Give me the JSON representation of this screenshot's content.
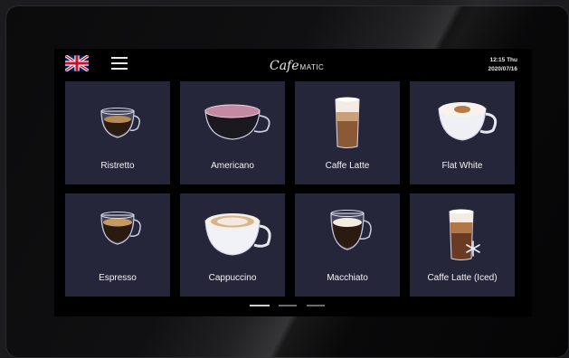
{
  "header": {
    "brand_script": "Cafe",
    "brand_suffix": "MATIC",
    "time": "12:15 Thu",
    "date": "2020/07/16",
    "language_icon": "uk-flag-icon",
    "menu_icon": "hamburger-menu-icon"
  },
  "drinks": [
    {
      "label": "Ristretto",
      "icon": "ristretto-cup-icon"
    },
    {
      "label": "Americano",
      "icon": "americano-cup-icon"
    },
    {
      "label": "Caffe Latte",
      "icon": "latte-glass-icon"
    },
    {
      "label": "Flat White",
      "icon": "flat-white-cup-icon"
    },
    {
      "label": "Espresso",
      "icon": "espresso-cup-icon"
    },
    {
      "label": "Cappuccino",
      "icon": "cappuccino-cup-icon"
    },
    {
      "label": "Macchiato",
      "icon": "macchiato-cup-icon"
    },
    {
      "label": "Caffe Latte (Iced)",
      "icon": "iced-latte-glass-icon"
    }
  ],
  "pagination": {
    "pages": 3,
    "current": 1
  },
  "colors": {
    "tile": "#26263a",
    "screen": "#000000",
    "text": "#f2f2f2"
  }
}
